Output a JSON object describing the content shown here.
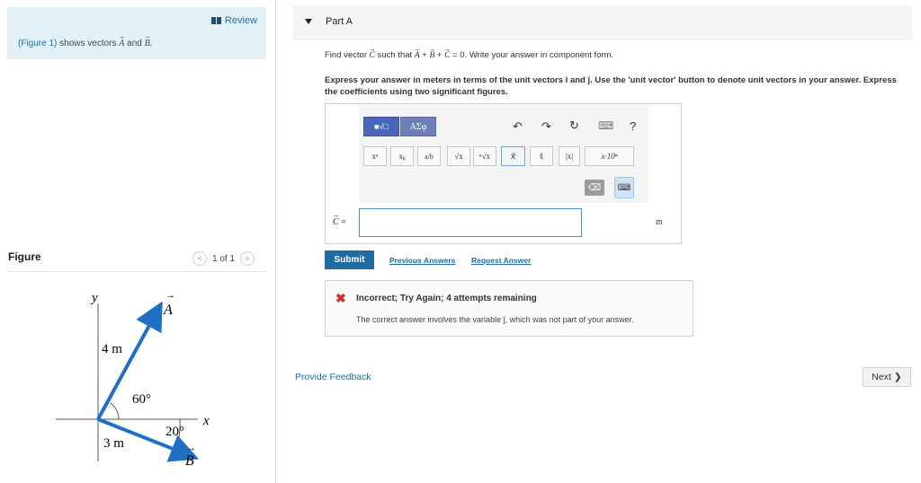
{
  "left": {
    "review_label": "Review",
    "intro": {
      "link": "(Figure 1)",
      "text_before": " shows vectors ",
      "vec_a": "A",
      "and": " and ",
      "vec_b": "B",
      "end": "."
    },
    "figure_label": "Figure",
    "pager": {
      "prev": "<",
      "text": "1 of 1",
      "next": ">"
    },
    "figure": {
      "y_axis": "y",
      "x_axis": "x",
      "vec_a": "A",
      "vec_b": "B",
      "len_a": "4 m",
      "len_b": "3 m",
      "angle_a": "60°",
      "angle_b": "20°"
    }
  },
  "part": {
    "title": "Part A"
  },
  "question": {
    "line1_a": "Find vector ",
    "c": "C",
    "line1_b": " such that ",
    "eq_a": "A",
    "plus1": " + ",
    "eq_b": "B",
    "plus2": " + ",
    "eq_c": "C",
    "eq_end": " = 0",
    "line1_c": ". Write your answer in component form.",
    "instructions": "Express your answer in meters in terms of the unit vectors î and ĵ. Use the 'unit vector' button to denote unit vectors in your answer. Express the coefficients using two significant figures."
  },
  "toolbar": {
    "templates": "■√□",
    "greek": "ΑΣφ",
    "undo": "↶",
    "redo": "↷",
    "reset": "↻",
    "keyboard": "⌨",
    "help": "?",
    "superscript": "xᵃ",
    "subscript": "xᵦ",
    "fraction": "a/b",
    "sqrt": "√x",
    "nthroot": "ⁿ√x",
    "vector": "x⃗",
    "unitvector": "x̂",
    "abs": "|x|",
    "sci": "x·10ⁿ",
    "backspace": "⌫",
    "kbd": "⌨"
  },
  "answer": {
    "label": "C =",
    "value": "",
    "unit": "m"
  },
  "actions": {
    "submit": "Submit",
    "previous": "Previous Answers",
    "request": "Request Answer"
  },
  "feedback": {
    "icon": "✖",
    "title": "Incorrect; Try Again; 4 attempts remaining",
    "message": "The correct answer involves the variable ĵ, which was not part of your answer."
  },
  "footer": {
    "provide_feedback": "Provide Feedback",
    "next": "Next",
    "next_chevron": "❯"
  },
  "colors": {
    "link": "#1d6fa5",
    "submit": "#1f6ca3",
    "vector": "#1f6fc4",
    "error": "#d0302a",
    "intro_bg": "#e3f1f8"
  }
}
